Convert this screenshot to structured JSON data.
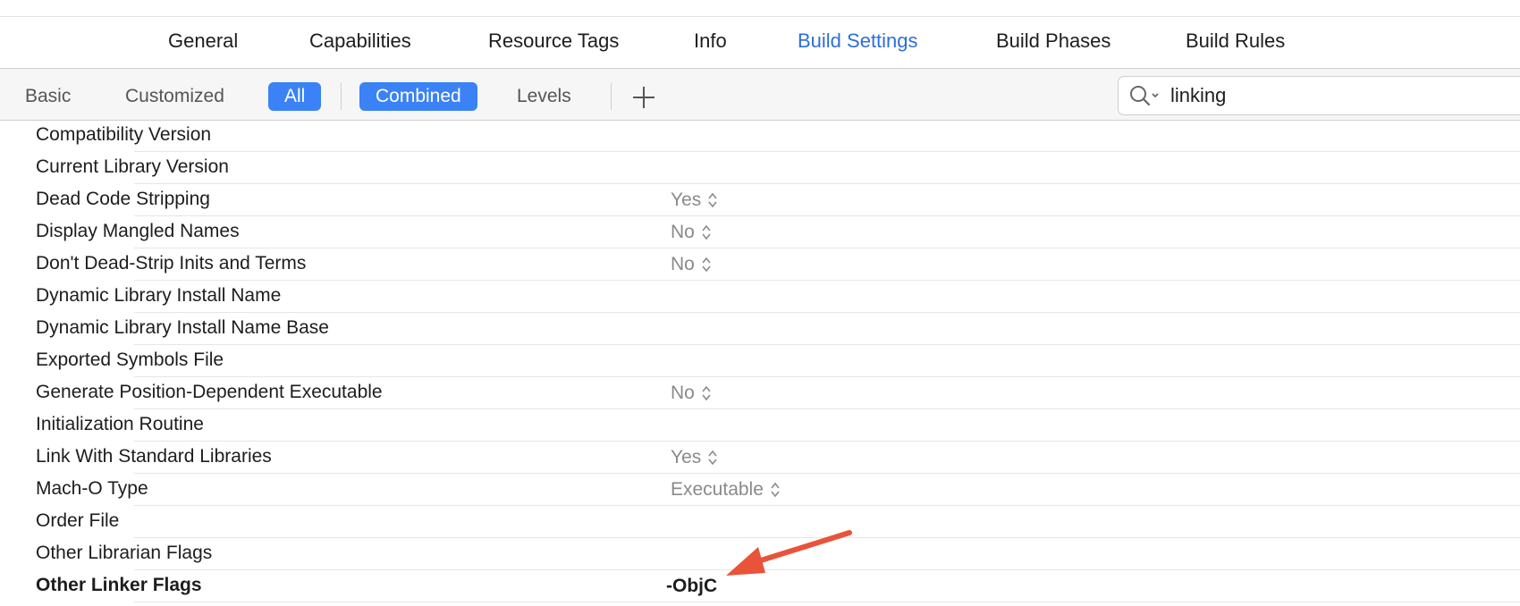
{
  "tabs": [
    {
      "label": "General",
      "active": false
    },
    {
      "label": "Capabilities",
      "active": false
    },
    {
      "label": "Resource Tags",
      "active": false
    },
    {
      "label": "Info",
      "active": false
    },
    {
      "label": "Build Settings",
      "active": true
    },
    {
      "label": "Build Phases",
      "active": false
    },
    {
      "label": "Build Rules",
      "active": false
    }
  ],
  "filters": {
    "basic": "Basic",
    "customized": "Customized",
    "all": "All",
    "combined": "Combined",
    "levels": "Levels"
  },
  "search": {
    "value": "linking"
  },
  "settings": [
    {
      "name": "Compatibility Version",
      "value": ""
    },
    {
      "name": "Current Library Version",
      "value": ""
    },
    {
      "name": "Dead Code Stripping",
      "value": "Yes"
    },
    {
      "name": "Display Mangled Names",
      "value": "No"
    },
    {
      "name": "Don't Dead-Strip Inits and Terms",
      "value": "No"
    },
    {
      "name": "Dynamic Library Install Name",
      "value": ""
    },
    {
      "name": "Dynamic Library Install Name Base",
      "value": ""
    },
    {
      "name": "Exported Symbols File",
      "value": ""
    },
    {
      "name": "Generate Position-Dependent Executable",
      "value": "No"
    },
    {
      "name": "Initialization Routine",
      "value": ""
    },
    {
      "name": "Link With Standard Libraries",
      "value": "Yes"
    },
    {
      "name": "Mach-O Type",
      "value": "Executable"
    },
    {
      "name": "Order File",
      "value": ""
    },
    {
      "name": "Other Librarian Flags",
      "value": ""
    },
    {
      "name": "Other Linker Flags",
      "value": "-ObjC"
    }
  ],
  "colors": {
    "accent": "#3a82f6",
    "active_tab": "#2e6fd8",
    "annotation": "#e8533a"
  },
  "icons": {
    "search": "search-icon",
    "add": "plus-icon",
    "stepper": "chevron-updown-icon",
    "annotation": "arrow-annotation"
  }
}
